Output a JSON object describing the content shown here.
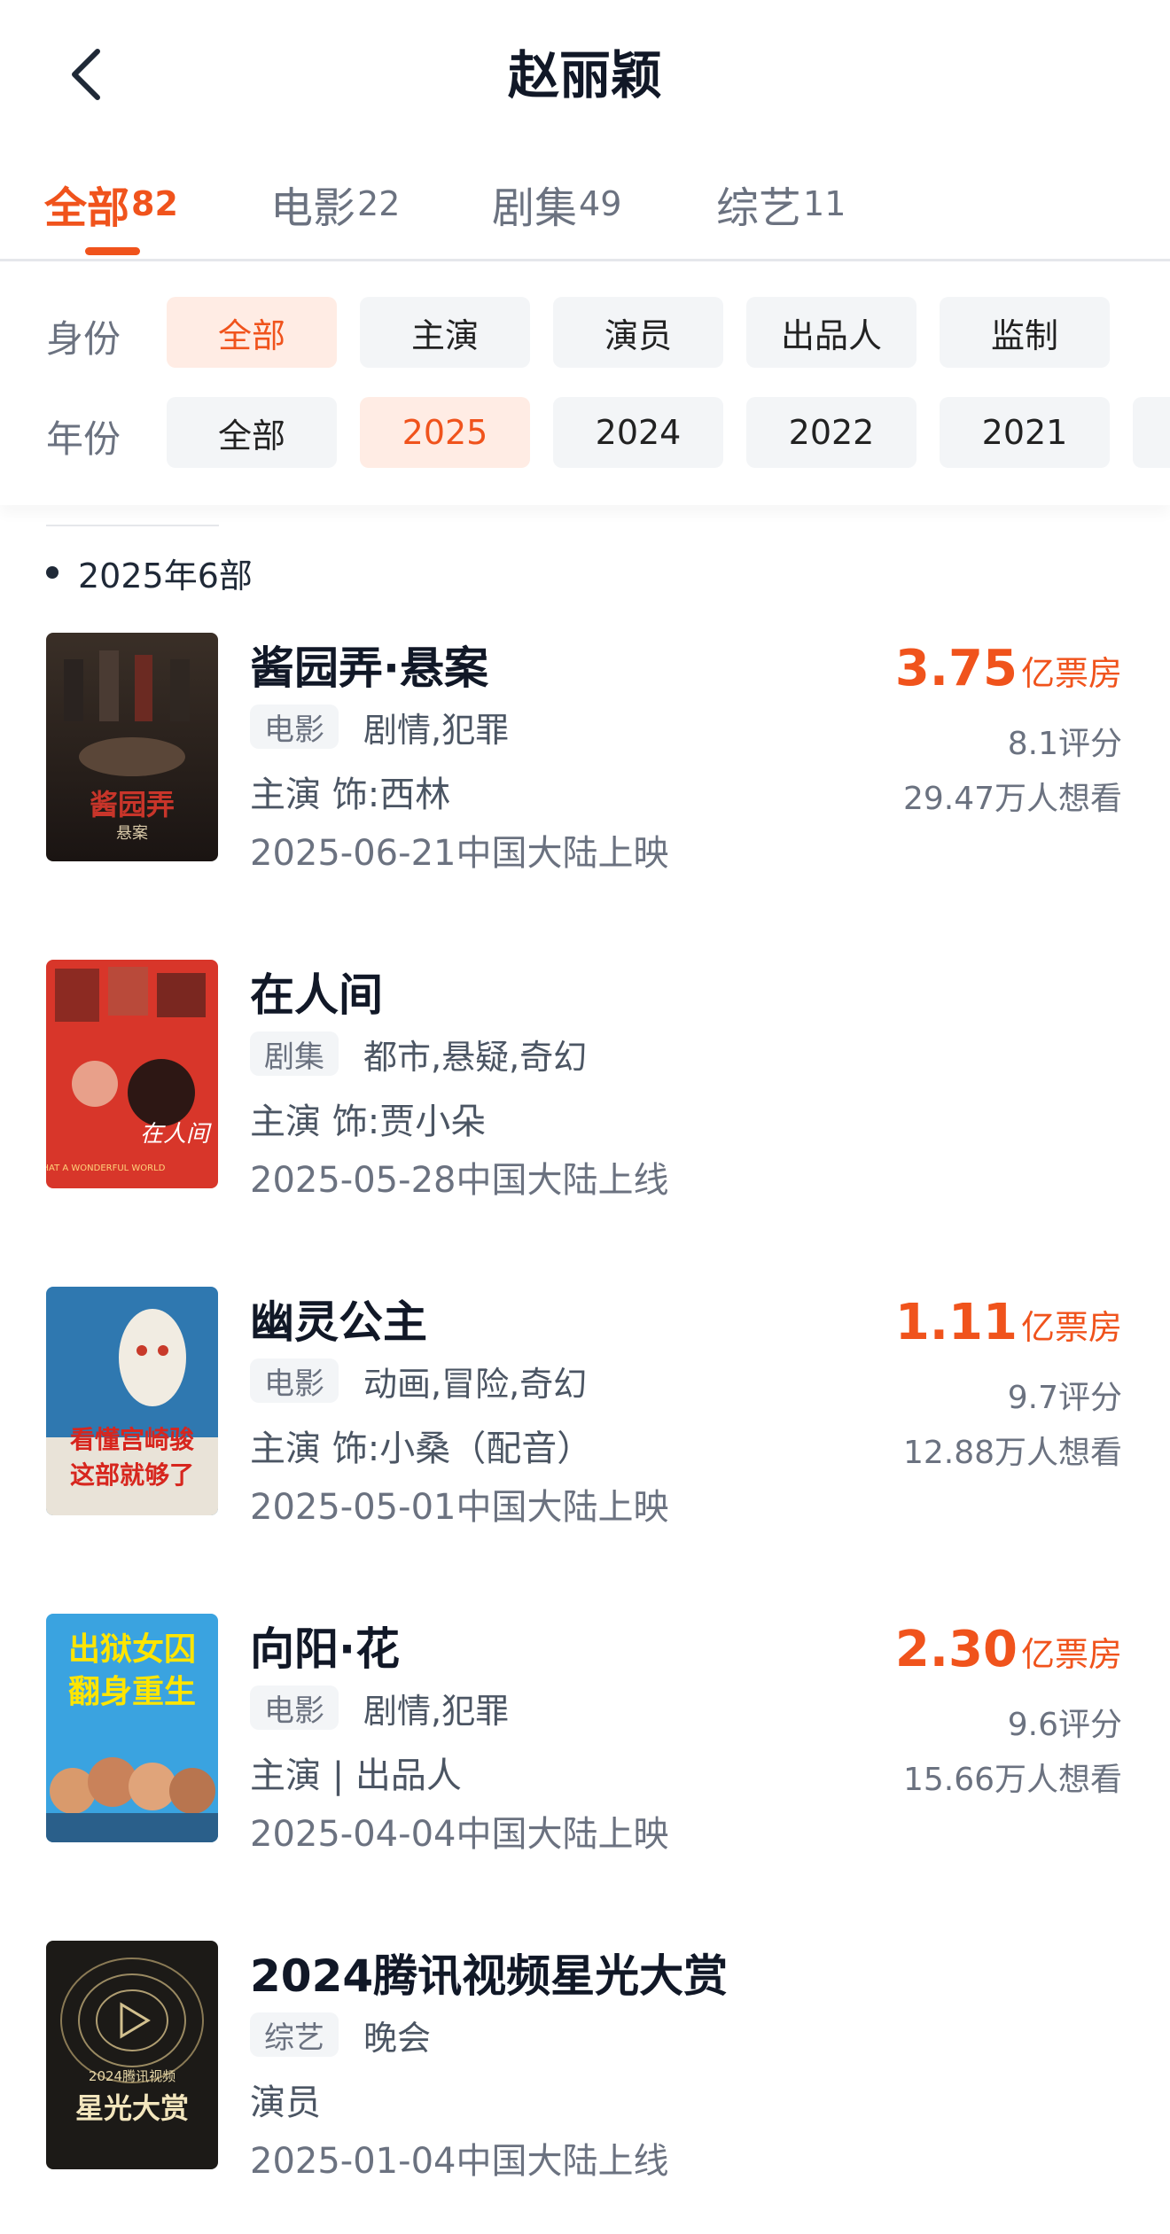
{
  "header": {
    "title": "赵丽颖",
    "back_icon": "chevron-left-icon"
  },
  "tabs": [
    {
      "label": "全部",
      "count": "82",
      "active": true
    },
    {
      "label": "电影",
      "count": "22",
      "active": false
    },
    {
      "label": "剧集",
      "count": "49",
      "active": false
    },
    {
      "label": "综艺",
      "count": "11",
      "active": false
    }
  ],
  "filters": {
    "identity": {
      "label": "身份",
      "options": [
        "全部",
        "主演",
        "演员",
        "出品人",
        "监制"
      ],
      "selected": "全部"
    },
    "year": {
      "label": "年份",
      "options": [
        "全部",
        "2025",
        "2024",
        "2022",
        "2021"
      ],
      "selected": "2025"
    }
  },
  "section": {
    "title": "2025年6部"
  },
  "items": [
    {
      "title": "酱园弄·悬案",
      "type": "电影",
      "genres": "剧情,犯罪",
      "role": "主演 饰:西林",
      "release": "2025-06-21中国大陆上映",
      "box_office": "3.75",
      "box_office_unit": "亿票房",
      "rating": "8.1评分",
      "want": "29.47万人想看"
    },
    {
      "title": "在人间",
      "type": "剧集",
      "genres": "都市,悬疑,奇幻",
      "role": "主演 饰:贾小朵",
      "release": "2025-05-28中国大陆上线"
    },
    {
      "title": "幽灵公主",
      "type": "电影",
      "genres": "动画,冒险,奇幻",
      "role": "主演 饰:小桑（配音）",
      "release": "2025-05-01中国大陆上映",
      "box_office": "1.11",
      "box_office_unit": "亿票房",
      "rating": "9.7评分",
      "want": "12.88万人想看"
    },
    {
      "title": "向阳·花",
      "type": "电影",
      "genres": "剧情,犯罪",
      "role": "主演 | 出品人",
      "release": "2025-04-04中国大陆上映",
      "box_office": "2.30",
      "box_office_unit": "亿票房",
      "rating": "9.6评分",
      "want": "15.66万人想看"
    },
    {
      "title": "2024腾讯视频星光大赏",
      "type": "综艺",
      "genres": "晚会",
      "role": "演员",
      "release": "2025-01-04中国大陆上线"
    }
  ],
  "posters": {
    "p0": {
      "text": "酱园弄",
      "subtext": "悬案"
    },
    "p1": {
      "text": "在人间",
      "subtext": "WHAT A WONDERFUL WORLD"
    },
    "p2": {
      "text": "看懂宫崎骏",
      "subtext": "这部就够了"
    },
    "p3": {
      "text": "出狱女囚",
      "subtext": "翻身重生"
    },
    "p4": {
      "text": "星光大赏",
      "subtext": "2024腾讯视频"
    }
  },
  "colors": {
    "accent": "#f0531c",
    "chip_bg": "#f3f5f7",
    "chip_active_bg": "#ffece4"
  }
}
